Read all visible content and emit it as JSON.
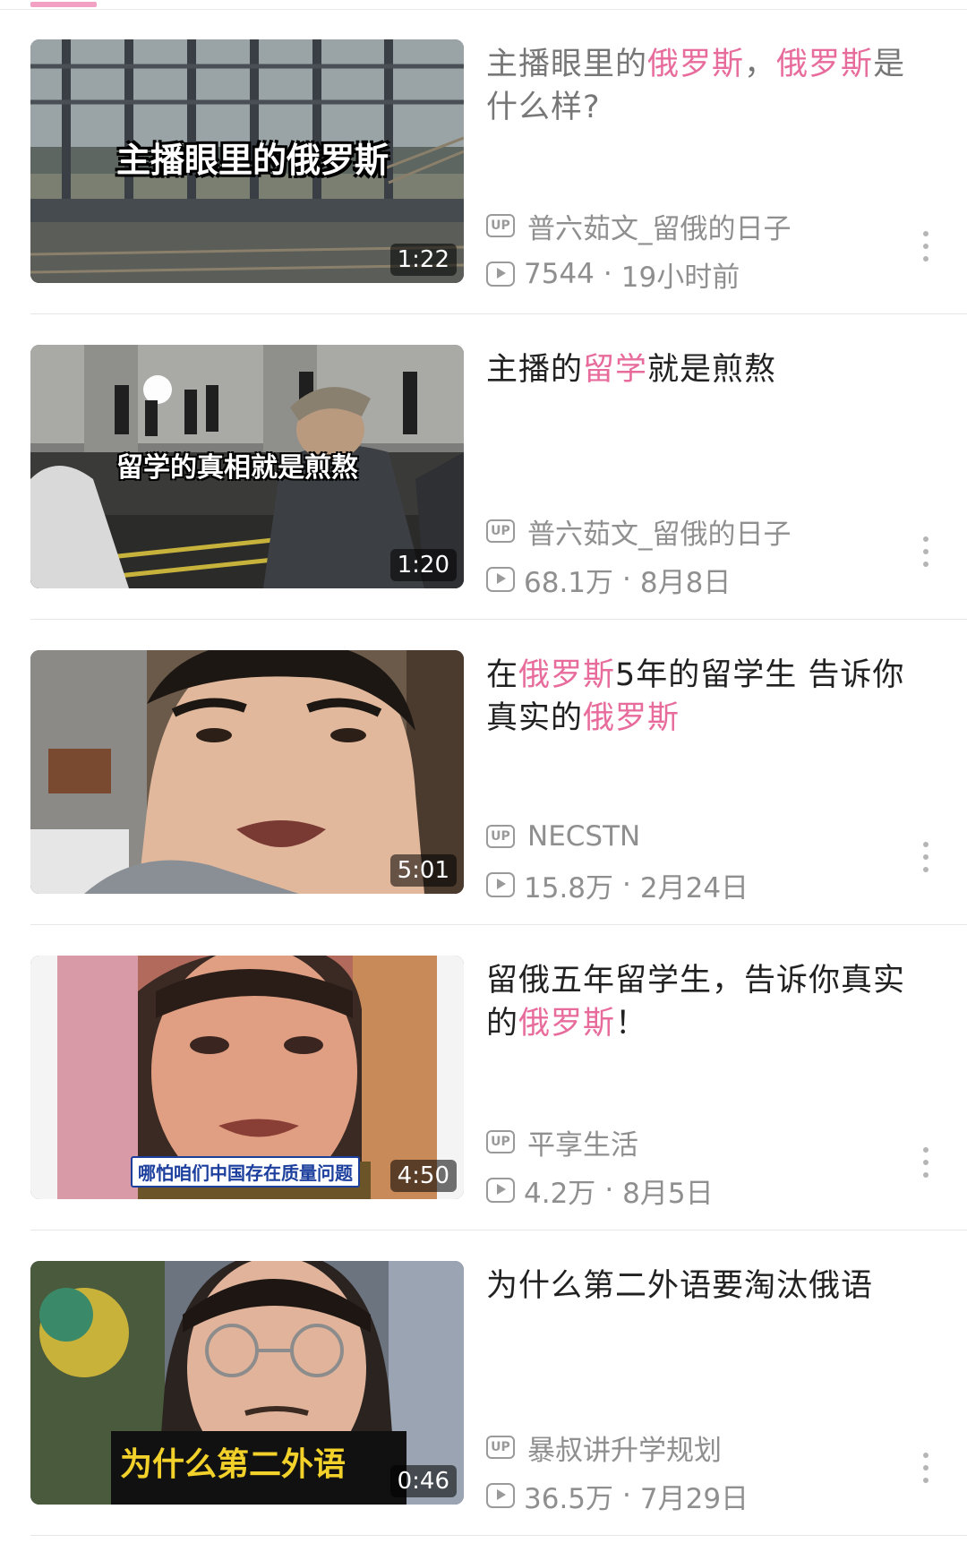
{
  "accent_color": "#e76c9c",
  "videos": [
    {
      "title_parts": [
        {
          "text": "主播眼里的",
          "style": "dim"
        },
        {
          "text": "俄罗斯",
          "style": "hl"
        },
        {
          "text": "，",
          "style": "dim"
        },
        {
          "text": "俄罗斯",
          "style": "hl"
        },
        {
          "text": "是什么样?",
          "style": "dim"
        }
      ],
      "thumb_caption": "主播眼里的俄罗斯",
      "duration": "1:22",
      "uploader": "普六茹文_留俄的日子",
      "views": "7544",
      "date": "19小时前"
    },
    {
      "title_parts": [
        {
          "text": "主播的",
          "style": "normal"
        },
        {
          "text": "留学",
          "style": "hl"
        },
        {
          "text": "就是煎熬",
          "style": "normal"
        }
      ],
      "thumb_caption": "留学的真相就是煎熬",
      "duration": "1:20",
      "uploader": "普六茹文_留俄的日子",
      "views": "68.1万",
      "date": "8月8日"
    },
    {
      "title_parts": [
        {
          "text": "在",
          "style": "normal"
        },
        {
          "text": "俄罗斯",
          "style": "hl"
        },
        {
          "text": "5年的留学生 告诉你真实的",
          "style": "normal"
        },
        {
          "text": "俄罗斯",
          "style": "hl"
        }
      ],
      "thumb_caption": "",
      "duration": "5:01",
      "uploader": "NECSTN",
      "views": "15.8万",
      "date": "2月24日"
    },
    {
      "title_parts": [
        {
          "text": "留俄五年留学生，告诉你真实的",
          "style": "normal"
        },
        {
          "text": "俄罗斯",
          "style": "hl"
        },
        {
          "text": "！",
          "style": "normal"
        }
      ],
      "thumb_caption": "哪怕咱们中国存在质量问题",
      "duration": "4:50",
      "uploader": "平享生活",
      "views": "4.2万",
      "date": "8月5日"
    },
    {
      "title_parts": [
        {
          "text": "为什么第二外语要淘汰俄语",
          "style": "normal"
        }
      ],
      "thumb_caption": "为什么第二外语",
      "duration": "0:46",
      "uploader": "暴叔讲升学规划",
      "views": "36.5万",
      "date": "7月29日"
    }
  ],
  "up_badge": "UP",
  "meta_separator": "·"
}
